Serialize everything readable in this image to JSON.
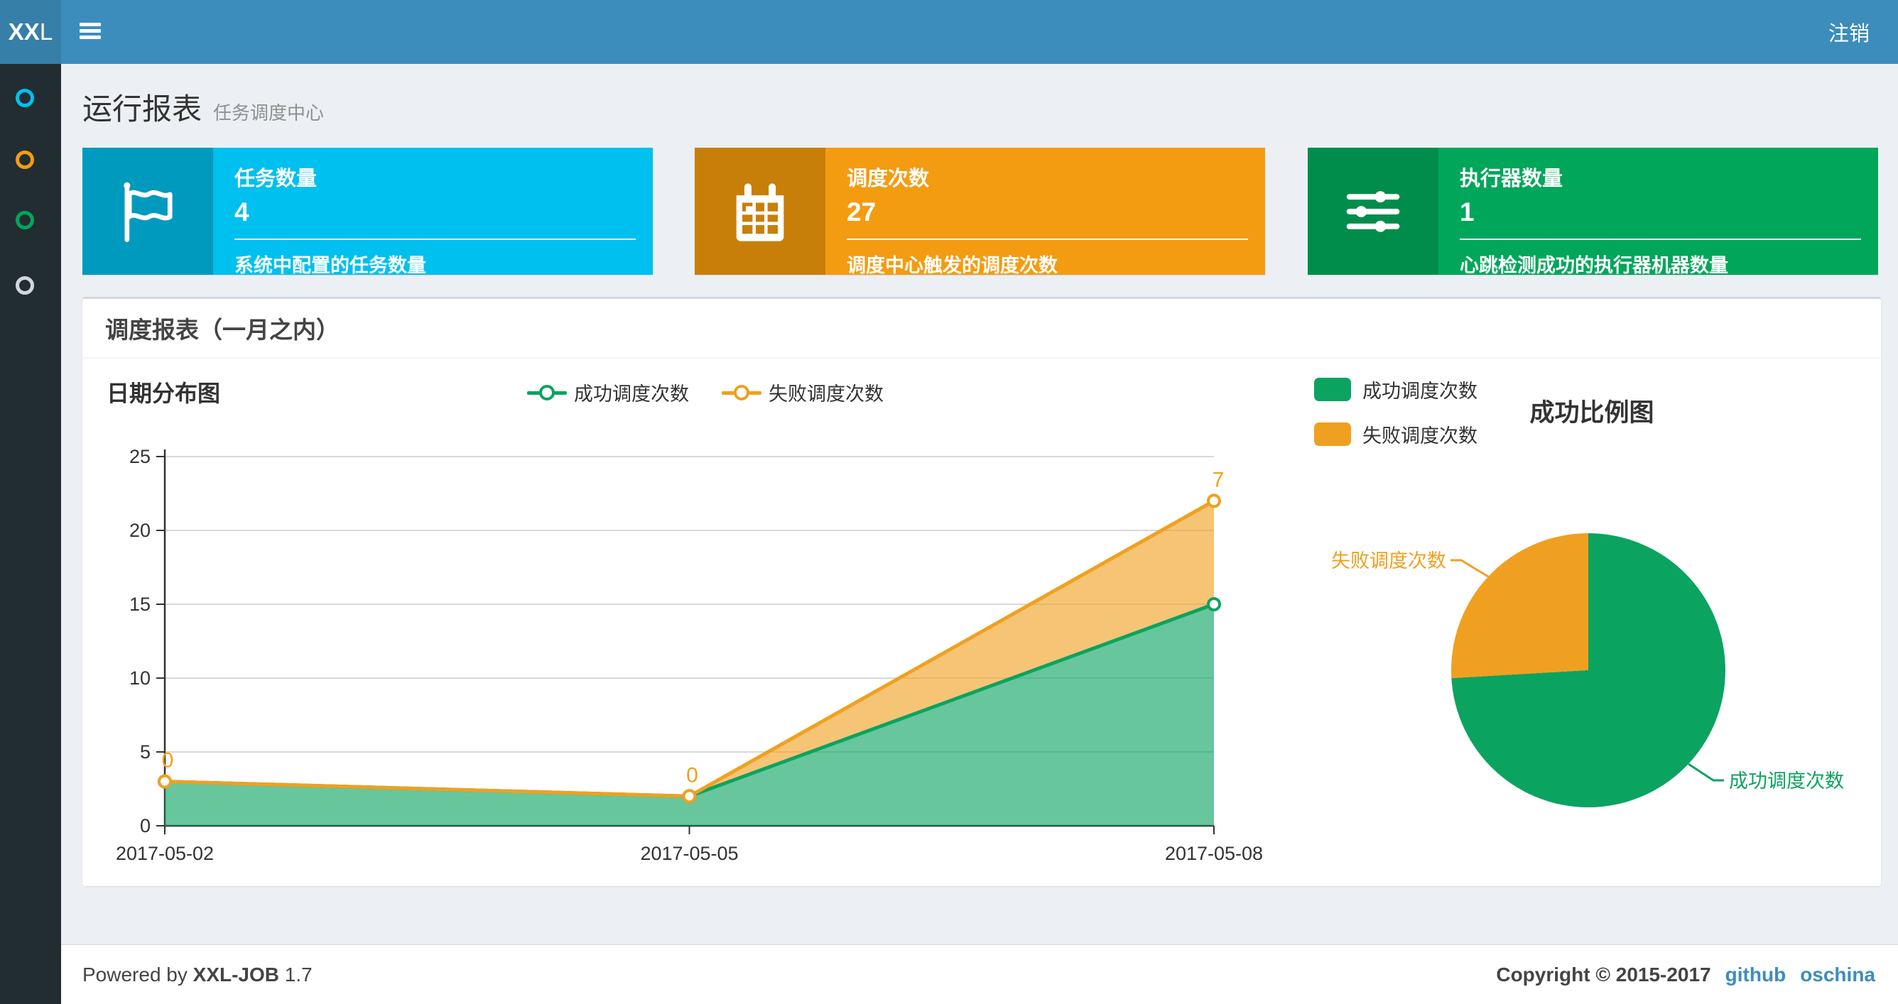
{
  "header": {
    "logo_bold": "XX",
    "logo_light": "L",
    "logout_label": "注销"
  },
  "sidebar": {
    "items": [
      {
        "name": "menu-1",
        "color": "#00c0ef"
      },
      {
        "name": "menu-2",
        "color": "#f39c12"
      },
      {
        "name": "menu-3",
        "color": "#00a65a"
      },
      {
        "name": "menu-4",
        "color": "#d2d6de"
      }
    ]
  },
  "page_header": {
    "title": "运行报表",
    "subtitle": "任务调度中心"
  },
  "info_boxes": [
    {
      "label": "任务数量",
      "value": "4",
      "desc": "系统中配置的任务数量",
      "bg": "#00c0ef",
      "icon_bg": "#009abf",
      "icon": "flag-icon"
    },
    {
      "label": "调度次数",
      "value": "27",
      "desc": "调度中心触发的调度次数",
      "bg": "#f39c12",
      "icon_bg": "#c87f0a",
      "icon": "calendar-icon"
    },
    {
      "label": "执行器数量",
      "value": "1",
      "desc": "心跳检测成功的执行器机器数量",
      "bg": "#00a65a",
      "icon_bg": "#008d4c",
      "icon": "sliders-icon"
    }
  ],
  "panel": {
    "title": "调度报表（一月之内）"
  },
  "chart_data": [
    {
      "type": "area",
      "title": "日期分布图",
      "stacked": true,
      "categories": [
        "2017-05-02",
        "2017-05-05",
        "2017-05-08"
      ],
      "series": [
        {
          "name": "成功调度次数",
          "color": "#0ba360",
          "values": [
            3,
            2,
            15
          ]
        },
        {
          "name": "失败调度次数",
          "color": "#f0a020",
          "values": [
            0,
            0,
            7
          ]
        }
      ],
      "point_labels_series": "失败调度次数",
      "point_labels": [
        "0",
        "0",
        "7"
      ],
      "ylim": [
        0,
        25
      ],
      "yticks": [
        0,
        5,
        10,
        15,
        20,
        25
      ],
      "grid": "horizontal",
      "legend_position": "top-center"
    },
    {
      "type": "pie",
      "title": "成功比例图",
      "slices": [
        {
          "name": "成功调度次数",
          "value": 20,
          "color": "#0ba360"
        },
        {
          "name": "失败调度次数",
          "value": 7,
          "color": "#f0a020"
        }
      ],
      "legend_position": "top-left"
    }
  ],
  "footer": {
    "powered_prefix": "Powered by",
    "brand": "XXL-JOB",
    "version": "1.7",
    "copyright": "Copyright © 2015-2017",
    "links": [
      {
        "label": "github"
      },
      {
        "label": "oschina"
      }
    ]
  }
}
